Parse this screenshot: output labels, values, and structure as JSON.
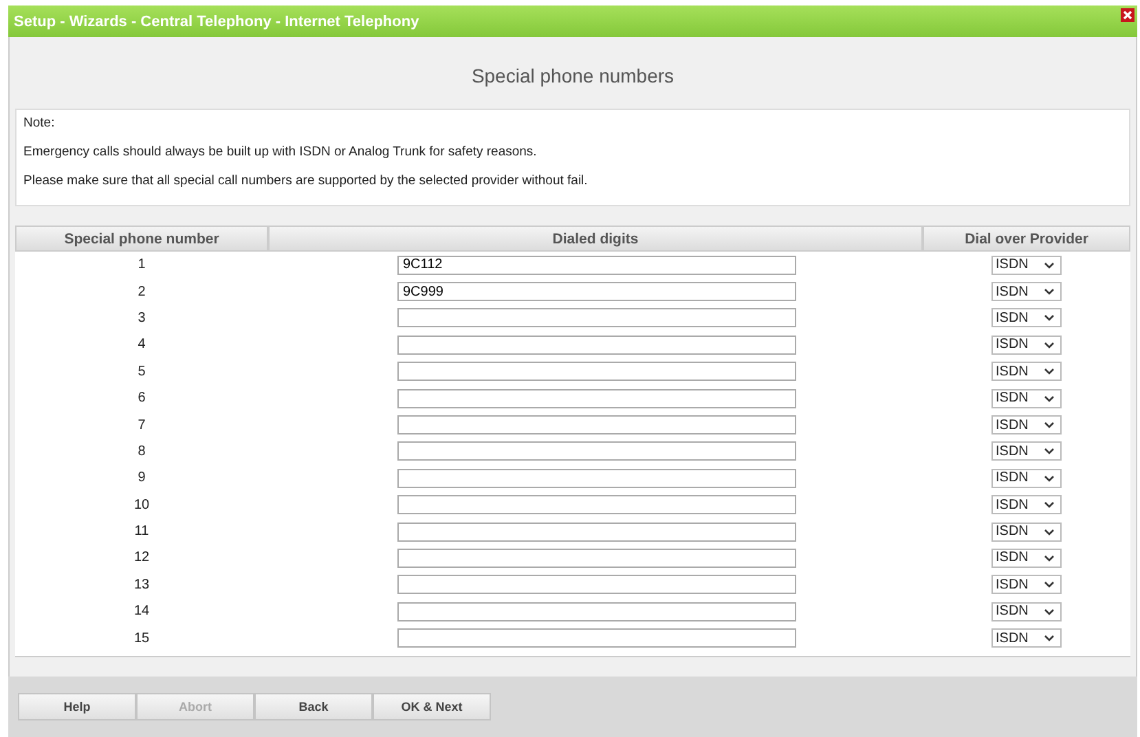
{
  "window": {
    "title": "Setup - Wizards - Central Telephony - Internet Telephony"
  },
  "heading": "Special phone numbers",
  "note": [
    "Note:",
    "Emergency calls should always be built up with ISDN or Analog Trunk for safety reasons.",
    "Please make sure that all special call numbers are supported by the selected provider without fail."
  ],
  "table": {
    "columns": [
      "Special phone number",
      "Dialed digits",
      "Dial over Provider"
    ],
    "rows": [
      {
        "number": "1",
        "digits": "9C112",
        "provider": "ISDN"
      },
      {
        "number": "2",
        "digits": "9C999",
        "provider": "ISDN"
      },
      {
        "number": "3",
        "provider": "ISDN"
      },
      {
        "number": "4",
        "provider": "ISDN"
      },
      {
        "number": "5",
        "provider": "ISDN"
      },
      {
        "number": "6",
        "provider": "ISDN"
      },
      {
        "number": "7",
        "provider": "ISDN"
      },
      {
        "number": "8",
        "provider": "ISDN"
      },
      {
        "number": "9",
        "provider": "ISDN"
      },
      {
        "number": "10",
        "provider": "ISDN"
      },
      {
        "number": "11",
        "provider": "ISDN"
      },
      {
        "number": "12",
        "provider": "ISDN"
      },
      {
        "number": "13",
        "provider": "ISDN"
      },
      {
        "number": "14",
        "provider": "ISDN"
      },
      {
        "number": "15",
        "provider": "ISDN"
      }
    ]
  },
  "buttons": [
    {
      "label": "Help",
      "disabled": false
    },
    {
      "label": "Abort",
      "disabled": true
    },
    {
      "label": "Back",
      "disabled": false
    },
    {
      "label": "OK & Next",
      "disabled": false
    }
  ]
}
